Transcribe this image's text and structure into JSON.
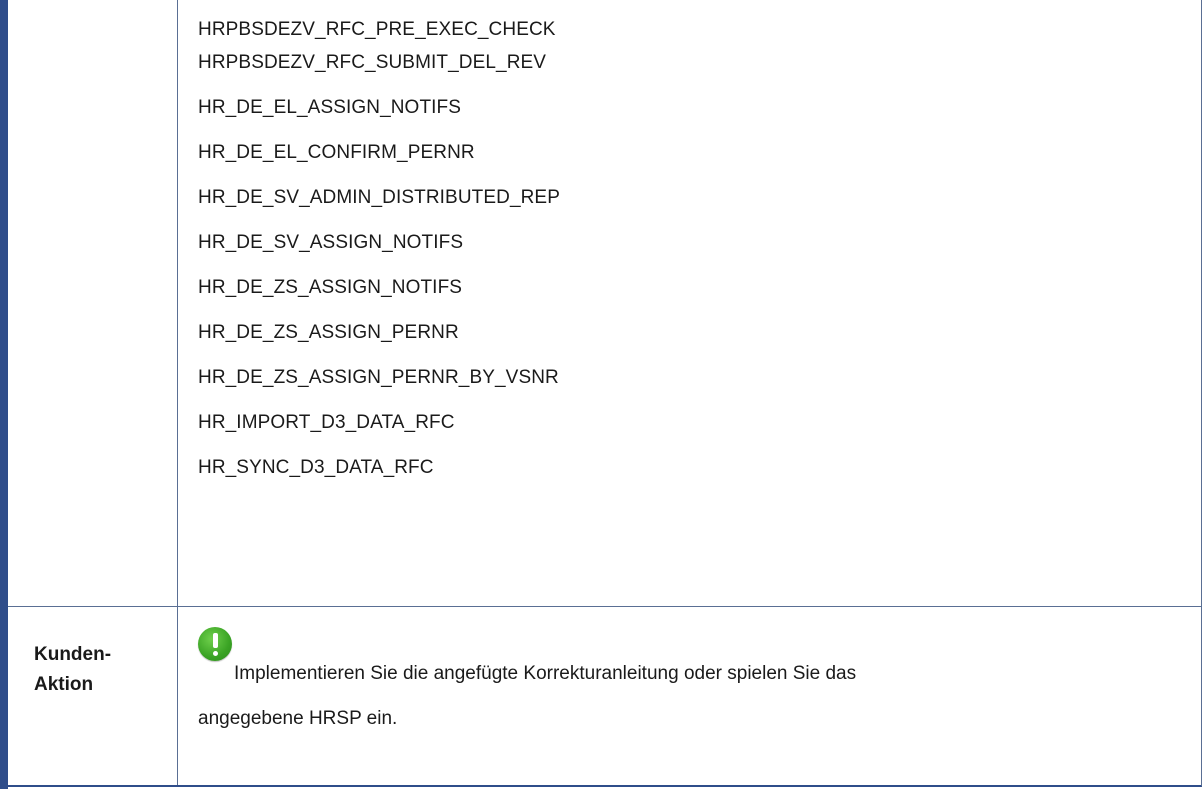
{
  "functions": [
    "HRPBSDEZV_RFC_PRE_EXEC_CHECK",
    "HRPBSDEZV_RFC_SUBMIT_DEL_REV",
    "HR_DE_EL_ASSIGN_NOTIFS",
    "HR_DE_EL_CONFIRM_PERNR",
    "HR_DE_SV_ADMIN_DISTRIBUTED_REP",
    "HR_DE_SV_ASSIGN_NOTIFS",
    "HR_DE_ZS_ASSIGN_NOTIFS",
    "HR_DE_ZS_ASSIGN_PERNR",
    "HR_DE_ZS_ASSIGN_PERNR_BY_VSNR",
    "HR_IMPORT_D3_DATA_RFC",
    "HR_SYNC_D3_DATA_RFC"
  ],
  "customer_action": {
    "label_line1": "Kunden-",
    "label_line2": "Aktion",
    "icon": "exclamation-icon",
    "text_line1": "Implementieren Sie die angefügte Korrekturanleitung oder spielen Sie das",
    "text_line2": "angegebene HRSP ein."
  },
  "colors": {
    "border": "#2f4d8a",
    "icon_green": "#3aa324"
  }
}
